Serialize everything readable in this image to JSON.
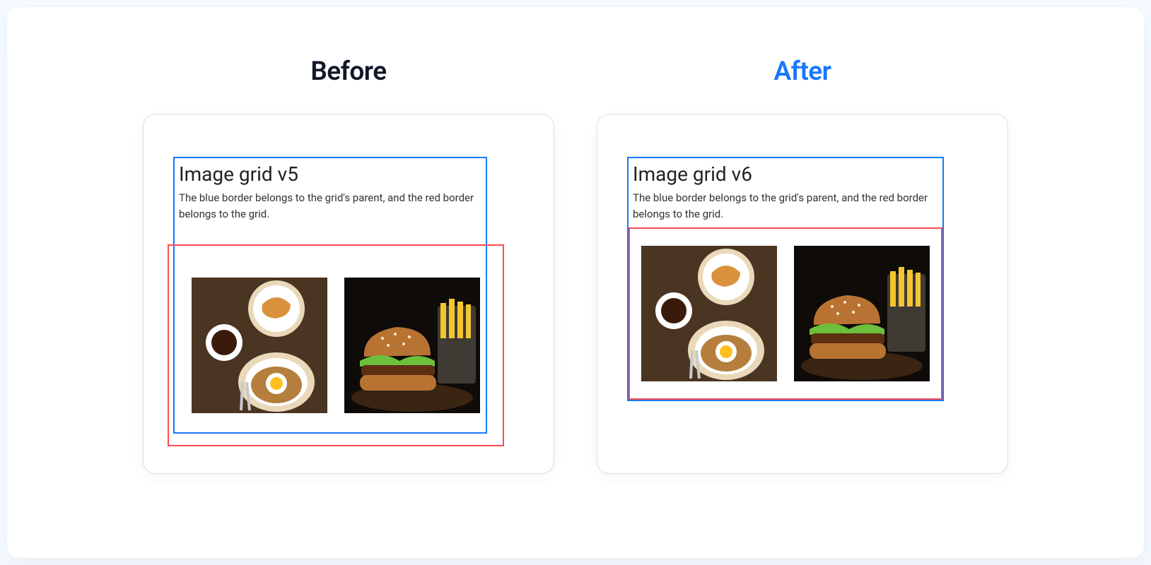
{
  "columns": {
    "before": {
      "heading": "Before"
    },
    "after": {
      "heading": "After"
    }
  },
  "example_before": {
    "title": "Image grid v5",
    "description": "The blue border belongs to the grid's parent, and the red border belongs to the grid.",
    "images": [
      {
        "alt": "breakfast-plate"
      },
      {
        "alt": "burger-and-fries"
      }
    ]
  },
  "example_after": {
    "title": "Image grid v6",
    "description": "The blue border belongs to the grid's parent, and the red border belongs to the grid.",
    "images": [
      {
        "alt": "breakfast-plate"
      },
      {
        "alt": "burger-and-fries"
      }
    ]
  },
  "colors": {
    "accent": "#1877ff",
    "grid_border": "#ff4d4f",
    "card_border": "#d9dde3"
  }
}
